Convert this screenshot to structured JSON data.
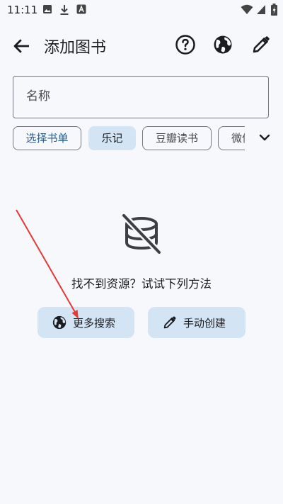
{
  "status_bar": {
    "time": "11:11",
    "left_icons": [
      "image-icon",
      "download-icon",
      "a-notification-icon"
    ],
    "right_icons": [
      "wifi-icon",
      "signal-icon",
      "battery-charging-icon"
    ]
  },
  "app_bar": {
    "title": "添加图书",
    "icons": [
      "back-arrow-icon",
      "help-circle-icon",
      "globe-icon",
      "edit-pencil-icon"
    ]
  },
  "search": {
    "placeholder": "名称",
    "value": ""
  },
  "sources": {
    "chips": [
      {
        "label": "选择书单",
        "selected": false
      },
      {
        "label": "乐记",
        "selected": true
      },
      {
        "label": "豆瓣读书",
        "selected": false
      },
      {
        "label": "微信读书",
        "selected": false
      }
    ],
    "expand_icon": "chevron-down-icon"
  },
  "empty_state": {
    "icon": "database-off-icon",
    "message": "找不到资源？试试下列方法"
  },
  "actions": {
    "more_search": {
      "label": "更多搜索",
      "icon": "globe-icon"
    },
    "manual_create": {
      "label": "手动创建",
      "icon": "pencil-icon"
    }
  },
  "colors": {
    "background": "#f7f8fc",
    "chip_selected": "#d3e4f5",
    "button_fill": "#d3e4f5",
    "accent_text": "#2a5d8f",
    "annotation_arrow": "#e53935"
  }
}
